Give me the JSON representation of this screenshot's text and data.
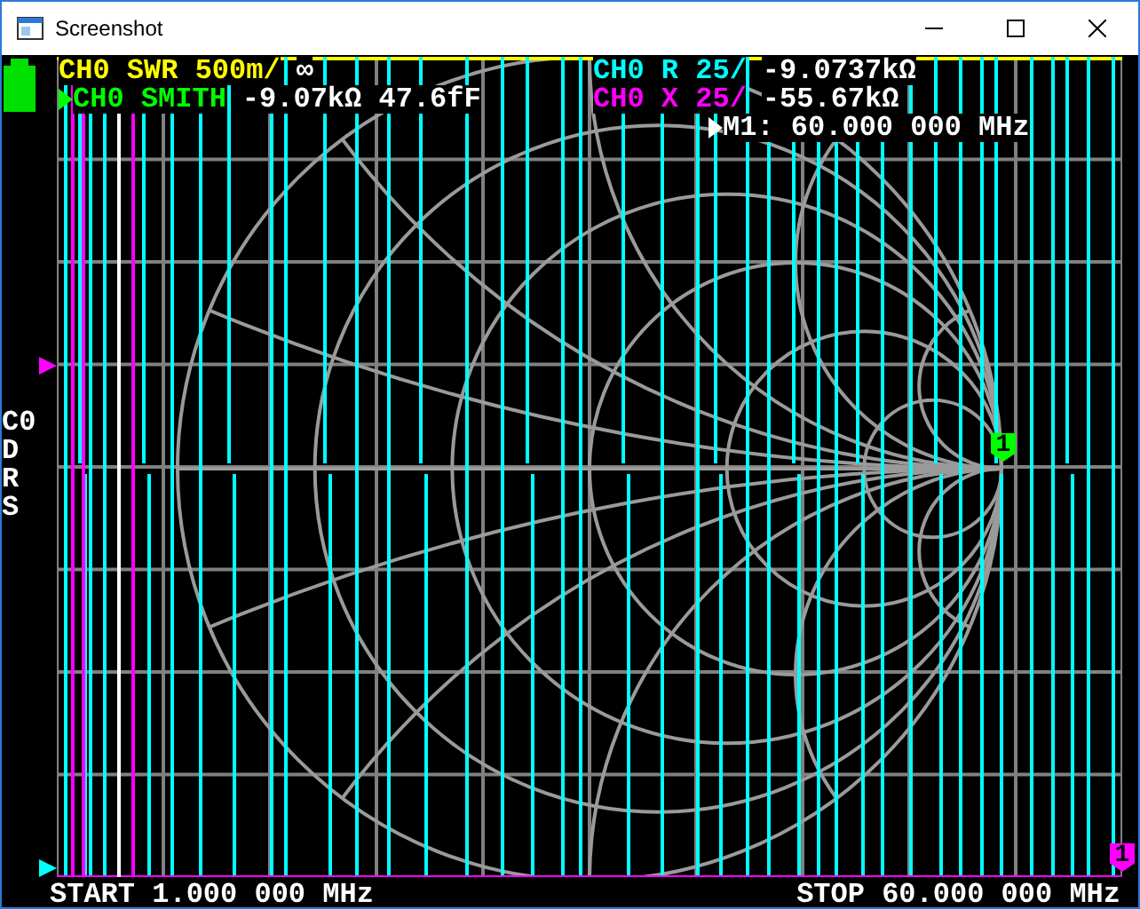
{
  "window": {
    "title": "Screenshot"
  },
  "traces": [
    {
      "label": "CH0 SWR 500m/",
      "value": "∞",
      "color": "#ffff00",
      "active": false
    },
    {
      "label": "CH0 SMITH",
      "value": "-9.07kΩ 47.6fF",
      "color": "#00ff00",
      "active": true
    },
    {
      "label": "CH0 R 25/",
      "value": "-9.0737kΩ",
      "color": "#00ffff",
      "active": false
    },
    {
      "label": "CH0 X 25/",
      "value": "-55.67kΩ",
      "color": "#ff00ff",
      "active": false
    }
  ],
  "marker_readout": "M1: 60.000 000 MHz",
  "chart_markers": [
    {
      "number": "1",
      "color": "#00ff00"
    },
    {
      "number": "1",
      "color": "#ff00ff"
    }
  ],
  "calibration": [
    "C0",
    "D",
    "R",
    "S"
  ],
  "sweep": {
    "start": "START 1.000 000 MHz",
    "stop": "STOP 60.000 000 MHz"
  }
}
